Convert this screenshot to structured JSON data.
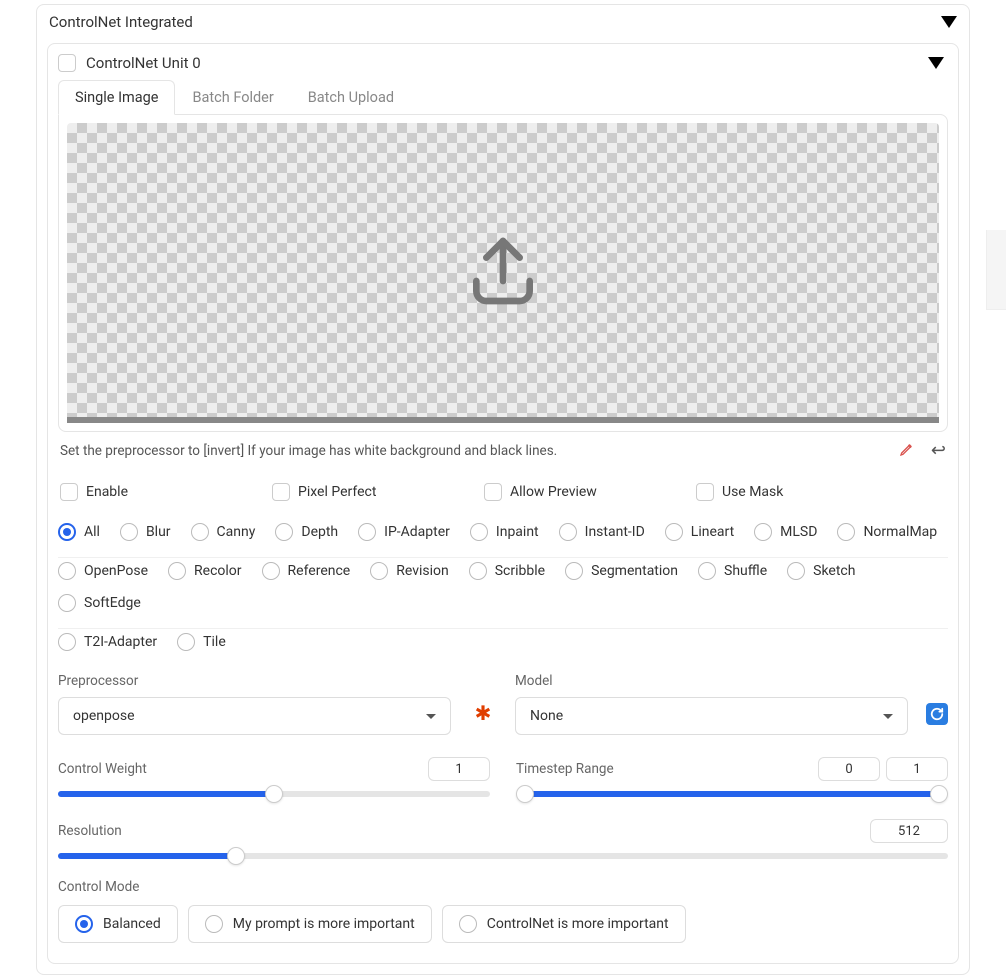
{
  "panel_title": "ControlNet Integrated",
  "unit_title": "ControlNet Unit 0",
  "tabs": [
    {
      "label": "Single Image",
      "active": true
    },
    {
      "label": "Batch Folder",
      "active": false
    },
    {
      "label": "Batch Upload",
      "active": false
    }
  ],
  "hint_text": "Set the preprocessor to [invert] If your image has white background and black lines.",
  "checkboxes": [
    {
      "label": "Enable",
      "checked": false
    },
    {
      "label": "Pixel Perfect",
      "checked": false
    },
    {
      "label": "Allow Preview",
      "checked": false
    },
    {
      "label": "Use Mask",
      "checked": false
    }
  ],
  "control_types_row1": [
    {
      "label": "All",
      "checked": true
    },
    {
      "label": "Blur",
      "checked": false
    },
    {
      "label": "Canny",
      "checked": false
    },
    {
      "label": "Depth",
      "checked": false
    },
    {
      "label": "IP-Adapter",
      "checked": false
    },
    {
      "label": "Inpaint",
      "checked": false
    },
    {
      "label": "Instant-ID",
      "checked": false
    },
    {
      "label": "Lineart",
      "checked": false
    },
    {
      "label": "MLSD",
      "checked": false
    },
    {
      "label": "NormalMap",
      "checked": false
    }
  ],
  "control_types_row2": [
    {
      "label": "OpenPose",
      "checked": false
    },
    {
      "label": "Recolor",
      "checked": false
    },
    {
      "label": "Reference",
      "checked": false
    },
    {
      "label": "Revision",
      "checked": false
    },
    {
      "label": "Scribble",
      "checked": false
    },
    {
      "label": "Segmentation",
      "checked": false
    },
    {
      "label": "Shuffle",
      "checked": false
    },
    {
      "label": "Sketch",
      "checked": false
    },
    {
      "label": "SoftEdge",
      "checked": false
    }
  ],
  "control_types_row3": [
    {
      "label": "T2I-Adapter",
      "checked": false
    },
    {
      "label": "Tile",
      "checked": false
    }
  ],
  "preprocessor": {
    "label": "Preprocessor",
    "value": "openpose"
  },
  "model": {
    "label": "Model",
    "value": "None"
  },
  "control_weight": {
    "label": "Control Weight",
    "value": "1",
    "pct": 50
  },
  "timestep": {
    "label": "Timestep Range",
    "low": "0",
    "high": "1",
    "low_pct": 2,
    "high_pct": 98
  },
  "resolution": {
    "label": "Resolution",
    "value": "512",
    "pct": 20
  },
  "control_mode": {
    "label": "Control Mode",
    "options": [
      {
        "label": "Balanced",
        "checked": true
      },
      {
        "label": "My prompt is more important",
        "checked": false
      },
      {
        "label": "ControlNet is more important",
        "checked": false
      }
    ]
  }
}
